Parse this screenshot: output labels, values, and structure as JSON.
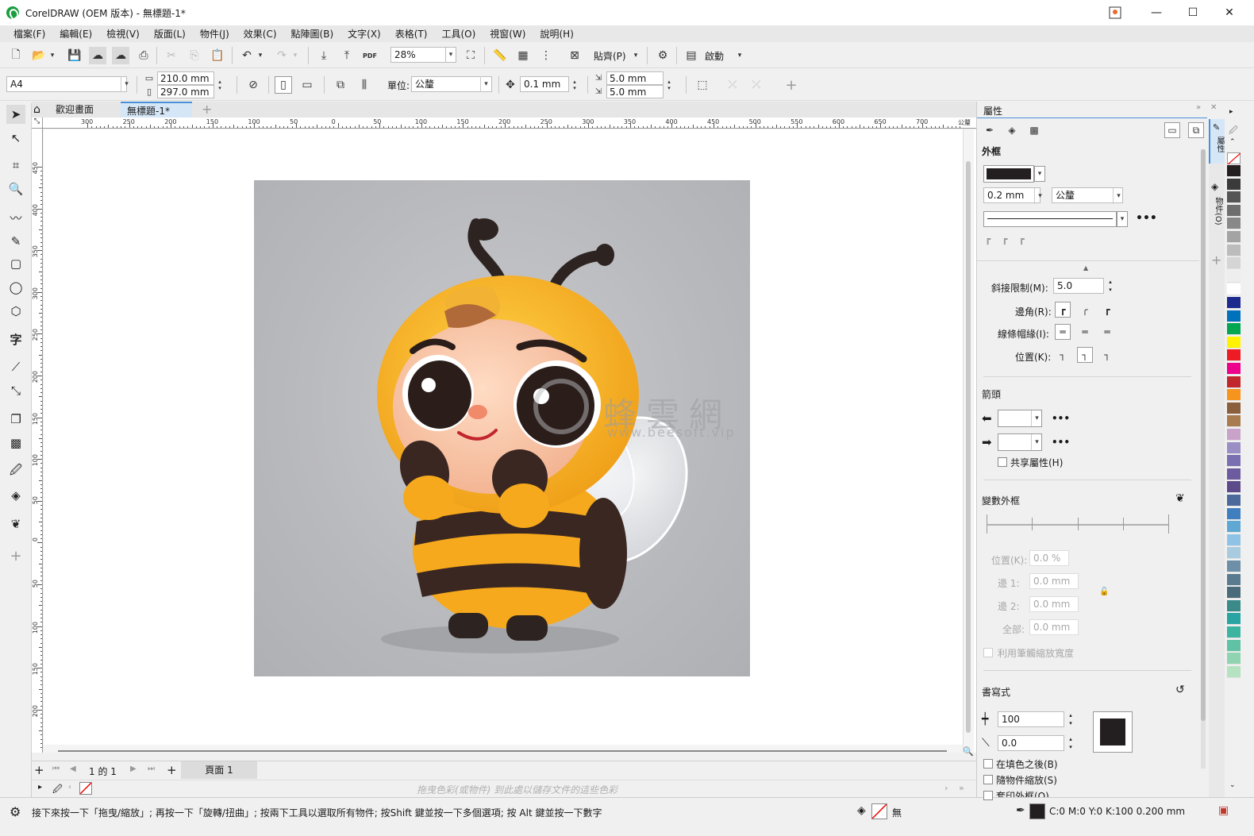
{
  "app": {
    "title": "CorelDRAW (OEM 版本) - 無標題-1*"
  },
  "menu": [
    "檔案(F)",
    "編輯(E)",
    "檢視(V)",
    "版面(L)",
    "物件(J)",
    "效果(C)",
    "點陣圖(B)",
    "文字(X)",
    "表格(T)",
    "工具(O)",
    "視窗(W)",
    "說明(H)"
  ],
  "toolbar1": {
    "zoom": "28%",
    "snap_label": "貼齊(P)",
    "launch_label": "啟動",
    "pdf_label": "PDF"
  },
  "toolbar2": {
    "page_size": "A4",
    "width": "210.0 mm",
    "height": "297.0 mm",
    "units_label": "單位:",
    "units_value": "公釐",
    "nudge": "0.1 mm",
    "dup_x": "5.0 mm",
    "dup_y": "5.0 mm"
  },
  "tabs": {
    "welcome": "歡迎畫面",
    "doc": "無標題-1*"
  },
  "hruler_labels": [
    "300",
    "250",
    "200",
    "150",
    "100",
    "50",
    "0",
    "50",
    "100",
    "150",
    "200",
    "250",
    "300",
    "350",
    "400",
    "450",
    "500",
    "550",
    "600",
    "650",
    "700"
  ],
  "hruler_unit": "公釐",
  "vruler_labels": [
    "450",
    "400",
    "350",
    "300",
    "250",
    "200",
    "150",
    "100",
    "50",
    "0",
    "50",
    "100",
    "150",
    "200"
  ],
  "canvas": {
    "watermark_cn": "蜂雲網",
    "watermark_url": "www.beesoft.vip"
  },
  "docnav": {
    "page_of": "1 的 1",
    "page_tab": "頁面 1"
  },
  "palette_hint": "拖曳色彩(或物件) 到此處以儲存文件的這些色彩",
  "status": {
    "hint": "接下來按一下「拖曳/縮放」; 再按一下「旋轉/扭曲」; 按兩下工具以選取所有物件; 按Shift 鍵並按一下多個選項; 按 Alt 鍵並按一下數字",
    "fill": "無",
    "outline": "C:0 M:0 Y:0 K:100  0.200 mm"
  },
  "docker": {
    "header": "屬性",
    "outline_section": "外框",
    "outline_width": "0.2 mm",
    "outline_units": "公釐",
    "miter_label": "斜接限制(M):",
    "miter_value": "5.0",
    "corners_label": "邊角(R):",
    "caps_label": "線條帽緣(I):",
    "position_label": "位置(K):",
    "arrows_section": "箭頭",
    "share_attr": "共享屬性(H)",
    "variable_section": "變數外框",
    "pos_label": "位置(K):",
    "pos_value": "0.0 %",
    "side1_label": "邊 1:",
    "side1_value": "0.0 mm",
    "side2_label": "邊 2:",
    "side2_value": "0.0 mm",
    "all_label": "全部:",
    "all_value": "0.0 mm",
    "scale_pen": "利用筆觸縮放寬度",
    "calligraphy_section": "書寫式",
    "stretch_value": "100",
    "angle_value": "0.0",
    "behind_fill": "在填色之後(B)",
    "scale_with": "隨物件縮放(S)",
    "overprint": "套印外框(O)"
  },
  "side_tabs": {
    "properties": "屬性",
    "objects": "物件(O)"
  },
  "palette_colors": [
    "#231f20",
    "#3a3a3a",
    "#555555",
    "#6e6e6e",
    "#888888",
    "#a3a3a3",
    "#bcbcbc",
    "#d5d5d5",
    "#eeeeee",
    "#ffffff",
    "#1d2b8f",
    "#0072bc",
    "#00a651",
    "#fff200",
    "#ed1c24",
    "#ec008c",
    "#c1272d",
    "#f7941d",
    "#8b5e3c",
    "#a97c50",
    "#c8a2c8",
    "#9b8ec4",
    "#7a6fb1",
    "#6c5b9e",
    "#5d4a8a",
    "#4b6a9b",
    "#3f7fbf",
    "#5fa8d3",
    "#8fc3e6",
    "#a9cbe0",
    "#6d8fa8",
    "#5a7a8f",
    "#4a6b7a",
    "#3a8a8a",
    "#2aa3a3",
    "#3cb4a0",
    "#60c2a4",
    "#8fd3b0",
    "#b5e3c2"
  ]
}
